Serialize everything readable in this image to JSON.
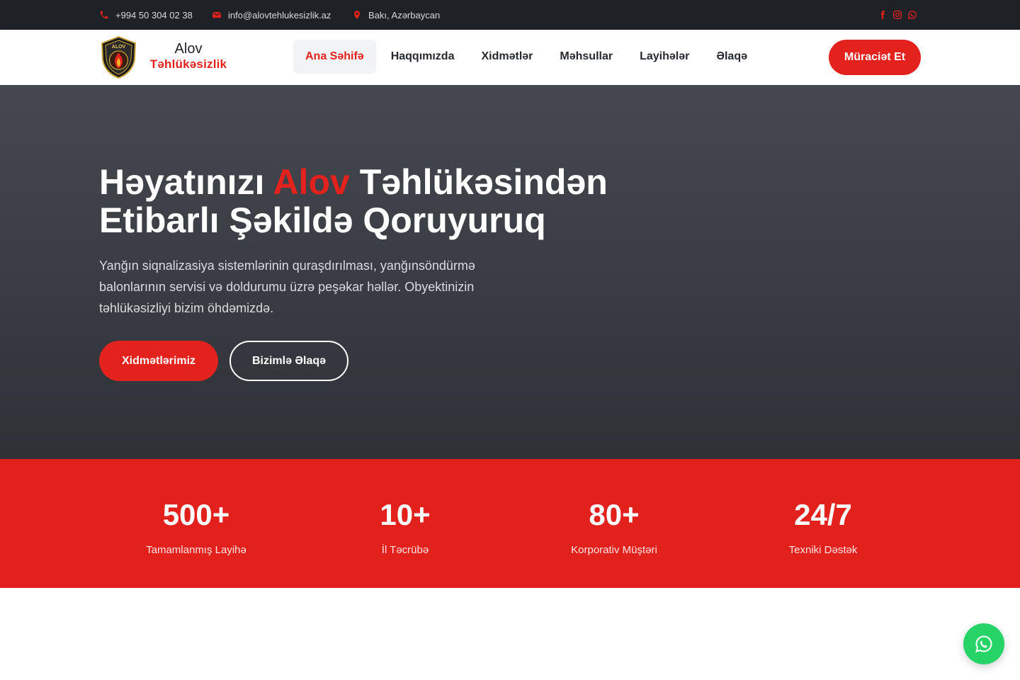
{
  "topbar": {
    "phone": "+994 50 304 02 38",
    "email": "info@alovtehlukesizlik.az",
    "location": "Bakı, Azərbaycan",
    "phone_icon": "phone-icon",
    "email_icon": "envelope-icon",
    "location_icon": "map-pin-icon",
    "socials": [
      "facebook-icon",
      "instagram-icon",
      "whatsapp-icon"
    ]
  },
  "brand": {
    "name_line1": "Alov",
    "name_line2": "Təhlükəsizlik",
    "logo_text": "ALOV"
  },
  "nav": {
    "items": [
      {
        "label": "Ana Səhifə",
        "active": true
      },
      {
        "label": "Haqqımızda",
        "active": false
      },
      {
        "label": "Xidmətlər",
        "active": false
      },
      {
        "label": "Məhsullar",
        "active": false
      },
      {
        "label": "Layihələr",
        "active": false
      },
      {
        "label": "Əlaqə",
        "active": false
      }
    ],
    "cta_label": "Müraciət Et"
  },
  "hero": {
    "title_part1": "Həyatınızı ",
    "title_accent": "Alov",
    "title_part2": " Təhlükəsindən Etibarlı Şəkildə Qoruyuruq",
    "lead": "Yanğın siqnalizasiya sistemlərinin quraşdırılması, yanğınsöndürmə balonlarının servisi və doldurumu üzrə peşəkar həllər. Obyektinizin təhlükəsizliyi bizim öhdəmizdə.",
    "primary_button": "Xidmətlərimiz",
    "secondary_button": "Bizimlə Əlaqə"
  },
  "stats": [
    {
      "value": "500+",
      "label": "Tamamlanmış Layihə"
    },
    {
      "value": "10+",
      "label": "İl Təcrübə"
    },
    {
      "value": "80+",
      "label": "Korporativ Müştəri"
    },
    {
      "value": "24/7",
      "label": "Texniki Dəstək"
    }
  ],
  "floating": {
    "icon": "whatsapp-icon"
  },
  "colors": {
    "accent": "#e3211d",
    "topbar_bg": "#1e2126",
    "hero_bg": "#3a3d43",
    "whatsapp": "#25d366"
  }
}
